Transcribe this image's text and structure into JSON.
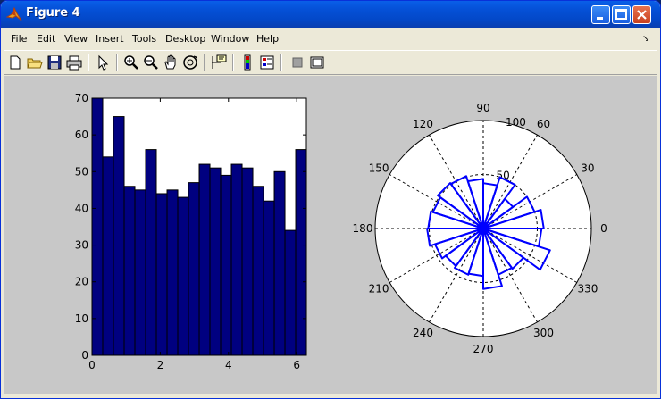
{
  "window": {
    "title": "Figure 4"
  },
  "menu": [
    "File",
    "Edit",
    "View",
    "Insert",
    "Tools",
    "Desktop",
    "Window",
    "Help"
  ],
  "toolbar_icons": [
    "new-file-icon",
    "open-folder-icon",
    "save-icon",
    "print-icon",
    "pointer-arrow-icon",
    "zoom-in-icon",
    "zoom-out-icon",
    "pan-hand-icon",
    "rotate-3d-icon",
    "data-cursor-icon",
    "colorbar-icon",
    "legend-icon",
    "hide-plot-tools-icon",
    "show-plot-tools-icon"
  ],
  "chart_data": [
    {
      "type": "bar",
      "title": "",
      "xlabel": "",
      "ylabel": "",
      "xlim": [
        0,
        6.2832
      ],
      "ylim": [
        0,
        70
      ],
      "xticks": [
        "0",
        "2",
        "4",
        "6"
      ],
      "yticks": [
        "0",
        "10",
        "20",
        "30",
        "40",
        "50",
        "60",
        "70"
      ],
      "bin_width": 0.3142,
      "values": [
        70,
        54,
        65,
        46,
        45,
        56,
        44,
        45,
        43,
        47,
        52,
        51,
        49,
        52,
        51,
        46,
        42,
        50,
        34,
        56
      ],
      "bar_color": "#000080",
      "edge_color": "#000000"
    },
    {
      "type": "polar-rose",
      "title": "",
      "r_max": 100,
      "r_ticks": [
        "50",
        "100"
      ],
      "angle_labels": [
        "0",
        "30",
        "60",
        "90",
        "120",
        "150",
        "180",
        "210",
        "240",
        "270",
        "300",
        "330"
      ],
      "bin_width_deg": 18,
      "values": [
        56,
        50,
        34,
        50,
        42,
        46,
        51,
        52,
        49,
        51,
        52,
        47,
        43,
        45,
        44,
        56,
        45,
        46,
        65,
        54
      ],
      "line_color": "#0000ff"
    }
  ]
}
